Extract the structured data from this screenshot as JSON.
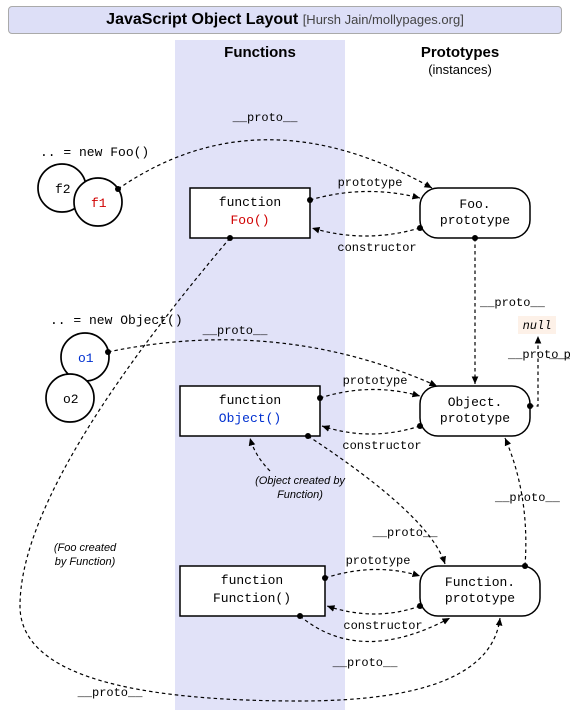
{
  "title": {
    "main": "JavaScript Object Layout",
    "attribution": "[Hursh Jain/mollypages.org]"
  },
  "columns": {
    "functions": "Functions",
    "prototypes": "Prototypes",
    "prototypes_sub": "(instances)"
  },
  "instances": {
    "foo_new": ".. = new Foo()",
    "f1": "f1",
    "f2": "f2",
    "obj_new": ".. = new Object()",
    "o1": "o1",
    "o2": "o2"
  },
  "functions": {
    "foo_kw": "function",
    "foo_name": "Foo()",
    "object_kw": "function",
    "object_name": "Object()",
    "function_kw": "function",
    "function_name": "Function()"
  },
  "prototypes": {
    "foo_l1": "Foo.",
    "foo_l2": "prototype",
    "object_l1": "Object.",
    "object_l2": "prototype",
    "function_l1": "Function.",
    "function_l2": "prototype"
  },
  "null_label": "null",
  "edge_labels": {
    "proto": "__proto__",
    "prototype": "prototype",
    "constructor": "constructor"
  },
  "notes": {
    "object_created": "(Object created by",
    "object_created2": "Function)",
    "foo_created": "(Foo created",
    "foo_created2": "by Function)"
  }
}
